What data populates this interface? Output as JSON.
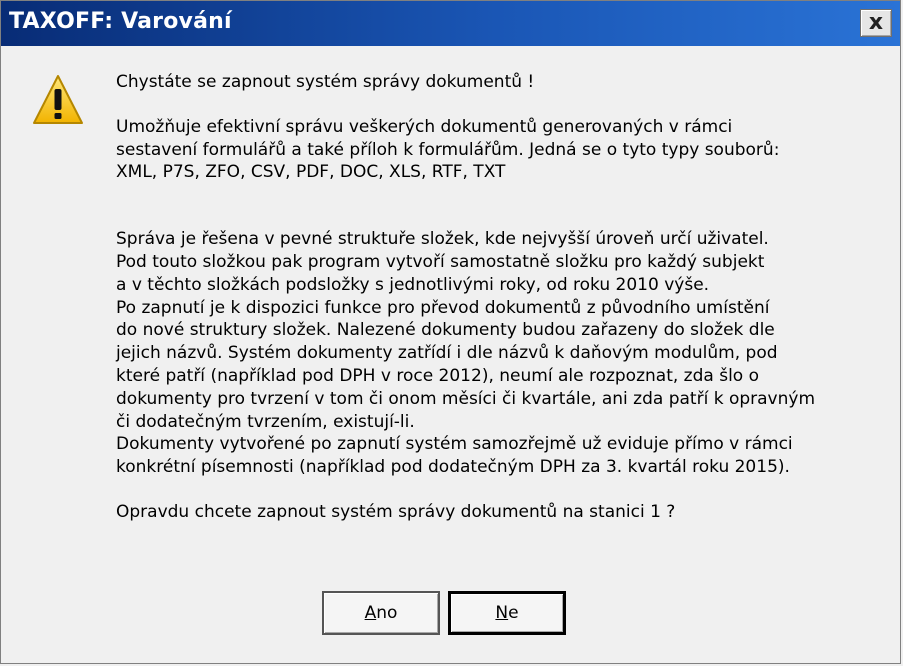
{
  "window": {
    "title": "TAXOFF: Varování",
    "close_glyph": "x"
  },
  "message": {
    "line1": "Chystáte se zapnout systém správy dokumentů !",
    "para1": "Umožňuje efektivní správu veškerých dokumentů generovaných v rámci\nsestavení formulářů a také příloh k formulářům. Jedná se o tyto typy souborů:\nXML, P7S, ZFO, CSV, PDF, DOC, XLS, RTF, TXT",
    "para2": "Správa je řešena v pevné struktuře složek, kde nejvyšší úroveň určí uživatel.\nPod touto složkou pak program vytvoří samostatně složku pro každý subjekt\na v těchto složkách podsložky s jednotlivými roky, od roku 2010 výše.\nPo zapnutí je k dispozici funkce pro převod dokumentů z původního umístění\ndo nové struktury složek. Nalezené dokumenty budou zařazeny do složek dle\njejich názvů. Systém dokumenty zatřídí i dle názvů k daňovým modulům, pod\nkteré patří (například pod DPH v roce 2012), neumí ale rozpoznat, zda šlo o\ndokumenty pro tvrzení v tom či onom měsíci či kvartále, ani zda patří k opravným\nči dodatečným tvrzením, existují-li.\nDokumenty vytvořené po zapnutí systém samozřejmě už eviduje přímo v rámci\nkonkrétní písemnosti (například pod dodatečným DPH za 3. kvartál roku 2015).",
    "question": "Opravdu chcete zapnout systém správy dokumentů na stanici 1 ?"
  },
  "buttons": {
    "yes_first": "A",
    "yes_rest": "no",
    "no_first": "N",
    "no_rest": "e"
  },
  "icons": {
    "window": "close-icon",
    "message": "warning-icon"
  },
  "colors": {
    "title_bg": "#1a56b5",
    "warning_fill": "#f5c400",
    "dialog_bg": "#f0f0f0"
  }
}
